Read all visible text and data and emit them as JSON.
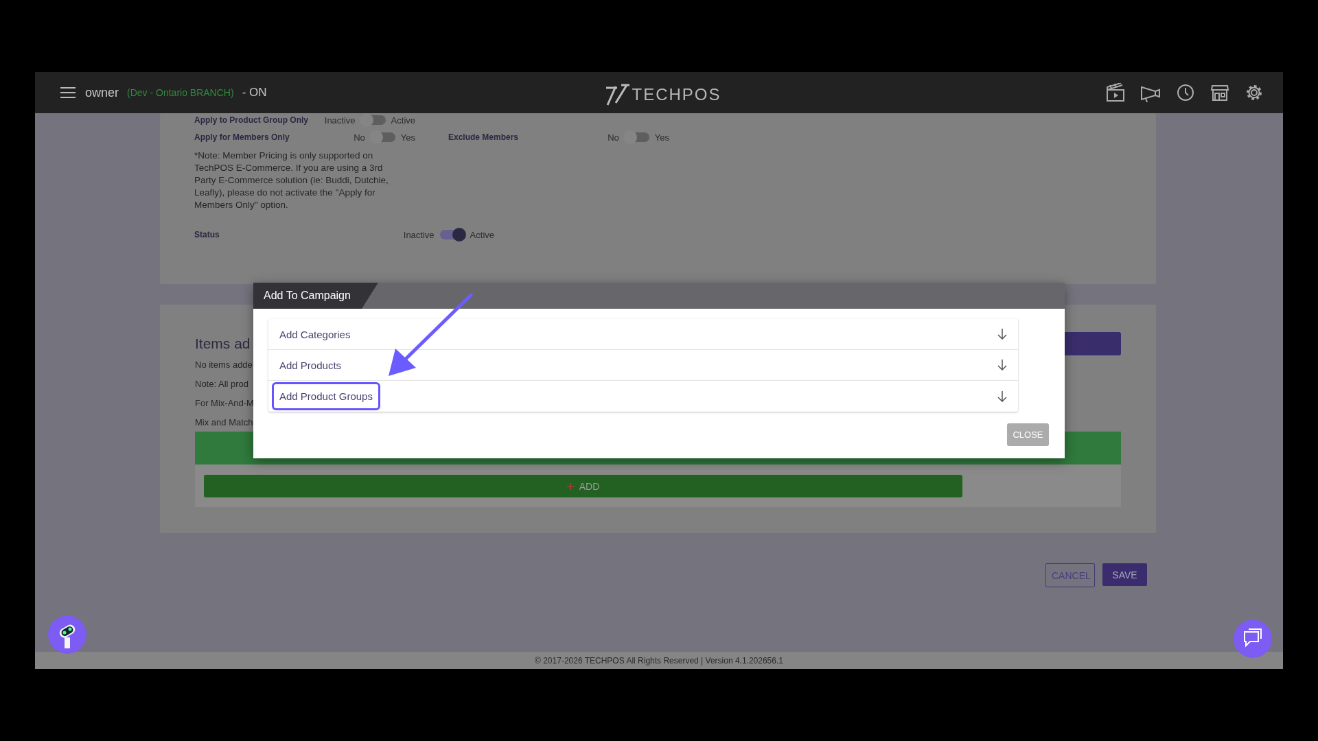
{
  "header": {
    "user": "owner",
    "branch": "(Dev - Ontario BRANCH)",
    "status": "- ON",
    "logo": "TECHPOS"
  },
  "settings_rows": [
    [
      {
        "label": "Apply to Product Group Only",
        "off_label": "Inactive",
        "on_label": "Active",
        "on": false
      }
    ],
    [
      {
        "label": "Apply for Members Only",
        "off_label": "No",
        "on_label": "Yes",
        "on": false
      },
      {
        "label": "Exclude Members",
        "off_label": "No",
        "on_label": "Yes",
        "on": false
      }
    ]
  ],
  "note": "*Note: Member Pricing is only supported on TechPOS E-Commerce. If you are using a 3rd Party E-Commerce solution (ie: Buddi, Dutchie, Leafly), please do not activate the \"Apply for Members Only\" option.",
  "status": {
    "label": "Status",
    "off_label": "Inactive",
    "on_label": "Active",
    "on": true
  },
  "items_section": {
    "heading": "Items ad",
    "lines": [
      "No items adde",
      "Note: All prod",
      "For Mix-And-M",
      "Mix and Match"
    ],
    "add_button": "ADD"
  },
  "footer_buttons": [
    "CANCEL",
    "SAVE"
  ],
  "copyright": "© 2017-2026 TECHPOS All Rights Reserved | Version 4.1.202656.1",
  "dialog": {
    "title": "Add To Campaign",
    "sections": [
      {
        "label": "Add Categories",
        "highlighted": false
      },
      {
        "label": "Add Products",
        "highlighted": false
      },
      {
        "label": "Add Product Groups",
        "highlighted": true
      }
    ],
    "close_button": "CLOSE"
  }
}
